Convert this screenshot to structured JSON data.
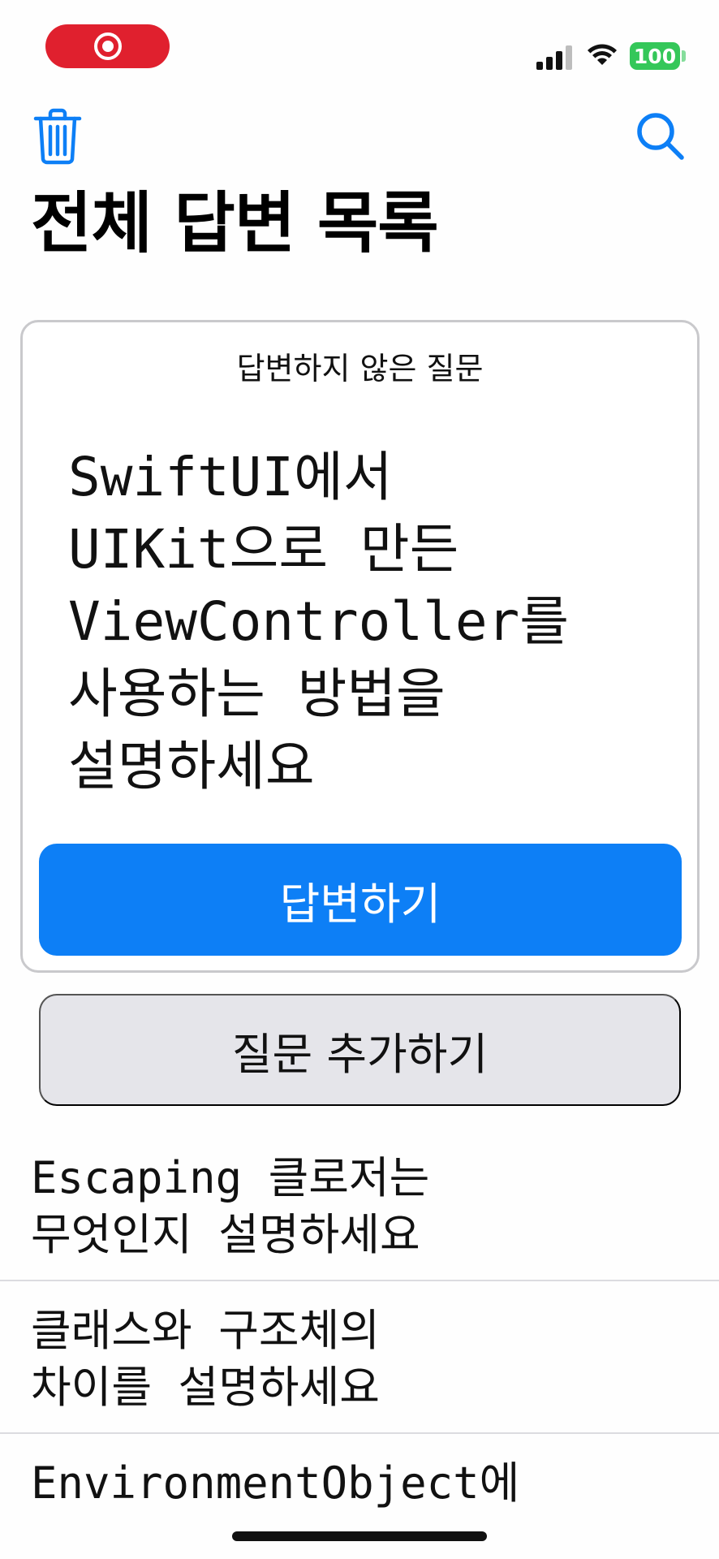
{
  "status_bar": {
    "recording_icon": "screen-recording-icon",
    "signal_icon": "cellular-signal-icon",
    "wifi_icon": "wifi-icon",
    "battery_level": "100",
    "battery_color": "#34c759",
    "recording_color": "#e0202e"
  },
  "nav": {
    "trash_icon": "trash-icon",
    "search_icon": "search-icon",
    "title": "전체 답변 목록",
    "accent": "#0d7ff6"
  },
  "card": {
    "caption": "답변하지 않은 질문",
    "question": "SwiftUI에서\nUIKit으로 만든\nViewController를\n사용하는 방법을\n설명하세요",
    "answer_label": "답변하기"
  },
  "add_question_label": "질문 추가하기",
  "answers": [
    {
      "text": "Escaping 클로저는\n무엇인지 설명하세요"
    },
    {
      "text": "클래스와 구조체의\n차이를 설명하세요"
    },
    {
      "text": "EnvironmentObject에"
    }
  ]
}
